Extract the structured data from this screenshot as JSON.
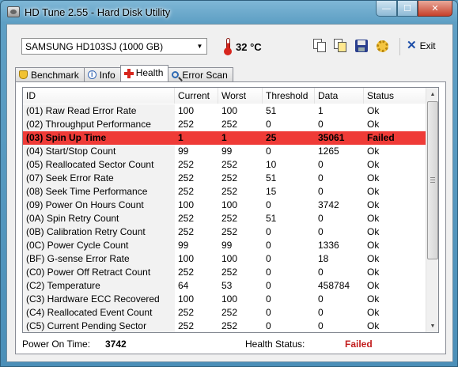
{
  "window": {
    "title": "HD Tune 2.55 - Hard Disk Utility",
    "minimize": "—",
    "maximize": "☐",
    "close": "✕"
  },
  "toolbar": {
    "drive": "SAMSUNG HD103SJ (1000 GB)",
    "temperature": "32 °C",
    "exit_label": "Exit",
    "icons": [
      "copy-icon",
      "copy-all-icon",
      "save-icon",
      "options-icon",
      "exit-icon"
    ]
  },
  "tabs": [
    {
      "label": "Benchmark",
      "icon": "trophy-icon"
    },
    {
      "label": "Info",
      "icon": "info-icon"
    },
    {
      "label": "Health",
      "icon": "health-cross-icon",
      "active": true
    },
    {
      "label": "Error Scan",
      "icon": "magnifier-icon"
    }
  ],
  "table": {
    "columns": [
      "ID",
      "Current",
      "Worst",
      "Threshold",
      "Data",
      "Status"
    ],
    "rows": [
      [
        "(01) Raw Read Error Rate",
        "100",
        "100",
        "51",
        "1",
        "Ok"
      ],
      [
        "(02) Throughput Performance",
        "252",
        "252",
        "0",
        "0",
        "Ok"
      ],
      [
        "(03) Spin Up Time",
        "1",
        "1",
        "25",
        "35061",
        "Failed"
      ],
      [
        "(04) Start/Stop Count",
        "99",
        "99",
        "0",
        "1265",
        "Ok"
      ],
      [
        "(05) Reallocated Sector Count",
        "252",
        "252",
        "10",
        "0",
        "Ok"
      ],
      [
        "(07) Seek Error Rate",
        "252",
        "252",
        "51",
        "0",
        "Ok"
      ],
      [
        "(08) Seek Time Performance",
        "252",
        "252",
        "15",
        "0",
        "Ok"
      ],
      [
        "(09) Power On Hours Count",
        "100",
        "100",
        "0",
        "3742",
        "Ok"
      ],
      [
        "(0A) Spin Retry Count",
        "252",
        "252",
        "51",
        "0",
        "Ok"
      ],
      [
        "(0B) Calibration Retry Count",
        "252",
        "252",
        "0",
        "0",
        "Ok"
      ],
      [
        "(0C) Power Cycle Count",
        "99",
        "99",
        "0",
        "1336",
        "Ok"
      ],
      [
        "(BF) G-sense Error Rate",
        "100",
        "100",
        "0",
        "18",
        "Ok"
      ],
      [
        "(C0) Power Off Retract Count",
        "252",
        "252",
        "0",
        "0",
        "Ok"
      ],
      [
        "(C2) Temperature",
        "64",
        "53",
        "0",
        "458784",
        "Ok"
      ],
      [
        "(C3) Hardware ECC Recovered",
        "100",
        "100",
        "0",
        "0",
        "Ok"
      ],
      [
        "(C4) Reallocated Event Count",
        "252",
        "252",
        "0",
        "0",
        "Ok"
      ],
      [
        "(C5) Current Pending Sector",
        "252",
        "252",
        "0",
        "0",
        "Ok"
      ]
    ],
    "failed_row_color": "#ef3b37"
  },
  "footer": {
    "power_on_label": "Power On Time:",
    "power_on_value": "3742",
    "health_label": "Health Status:",
    "health_value": "Failed"
  }
}
